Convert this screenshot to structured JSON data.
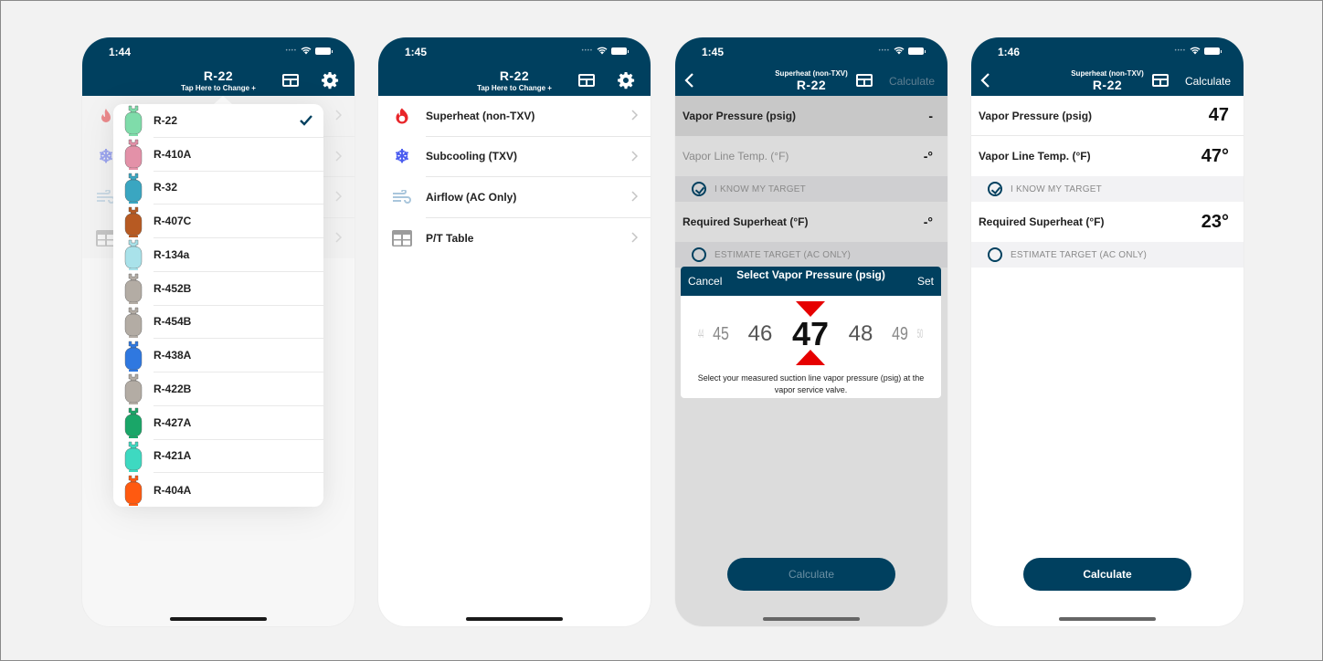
{
  "colors": {
    "brand": "#00405f",
    "accent_red": "#e60000",
    "superheat_icon": "#e8262a",
    "subcooling_icon": "#4a5cf0",
    "airflow_icon": "#a9c6dc",
    "table_icon": "#9c9c9c"
  },
  "screens": [
    {
      "status_time": "1:44",
      "header": {
        "title": "R-22",
        "subtitle": "Tap Here to Change +"
      },
      "refrigerants": [
        {
          "label": "R-22",
          "tank_color": "#7fdcaa",
          "selected": true
        },
        {
          "label": "R-410A",
          "tank_color": "#e391a8",
          "selected": false
        },
        {
          "label": "R-32",
          "tank_color": "#3aa6c1",
          "selected": false
        },
        {
          "label": "R-407C",
          "tank_color": "#b75a22",
          "selected": false
        },
        {
          "label": "R-134a",
          "tank_color": "#a9e2ea",
          "selected": false
        },
        {
          "label": "R-452B",
          "tank_color": "#b3aca4",
          "selected": false
        },
        {
          "label": "R-454B",
          "tank_color": "#b3aca4",
          "selected": false
        },
        {
          "label": "R-438A",
          "tank_color": "#2f78e0",
          "selected": false
        },
        {
          "label": "R-422B",
          "tank_color": "#b3aca4",
          "selected": false
        },
        {
          "label": "R-427A",
          "tank_color": "#1aa668",
          "selected": false
        },
        {
          "label": "R-421A",
          "tank_color": "#3ed9c1",
          "selected": false
        },
        {
          "label": "R-404A",
          "tank_color": "#ff5a10",
          "selected": false
        }
      ]
    },
    {
      "status_time": "1:45",
      "header": {
        "title": "R-22",
        "subtitle": "Tap Here to Change +"
      },
      "menu": [
        {
          "label": "Superheat (non-TXV)",
          "icon": "flame-icon"
        },
        {
          "label": "Subcooling (TXV)",
          "icon": "snowflake-icon"
        },
        {
          "label": "Airflow (AC Only)",
          "icon": "wind-icon"
        },
        {
          "label": "P/T Table",
          "icon": "table-icon"
        }
      ]
    },
    {
      "status_time": "1:45",
      "header": {
        "subtitle": "Superheat (non-TXV)",
        "title": "R-22",
        "action": "Calculate"
      },
      "fields": {
        "vapor_pressure": {
          "label": "Vapor Pressure (psig)",
          "value": "-"
        },
        "vapor_line_temp": {
          "label": "Vapor Line Temp. (°F)",
          "value": "-°"
        },
        "know_target": {
          "label": "I KNOW MY TARGET",
          "checked": true
        },
        "required_superheat": {
          "label": "Required Superheat (°F)",
          "value": "-°"
        },
        "estimate_target": {
          "label": "ESTIMATE TARGET (AC ONLY)",
          "checked": false
        }
      },
      "picker": {
        "cancel": "Cancel",
        "title": "Select Vapor Pressure (psig)",
        "set": "Set",
        "values": [
          "44",
          "45",
          "46",
          "47",
          "48",
          "49",
          "50"
        ],
        "selected": "47",
        "hint": "Select your measured suction line vapor pressure (psig) at the vapor service valve."
      },
      "calculate_button": "Calculate"
    },
    {
      "status_time": "1:46",
      "header": {
        "subtitle": "Superheat (non-TXV)",
        "title": "R-22",
        "action": "Calculate"
      },
      "fields": {
        "vapor_pressure": {
          "label": "Vapor Pressure (psig)",
          "value": "47"
        },
        "vapor_line_temp": {
          "label": "Vapor Line Temp. (°F)",
          "value": "47°"
        },
        "know_target": {
          "label": "I KNOW MY TARGET",
          "checked": true
        },
        "required_superheat": {
          "label": "Required Superheat (°F)",
          "value": "23°"
        },
        "estimate_target": {
          "label": "ESTIMATE TARGET (AC ONLY)",
          "checked": false
        }
      },
      "calculate_button": "Calculate"
    }
  ]
}
